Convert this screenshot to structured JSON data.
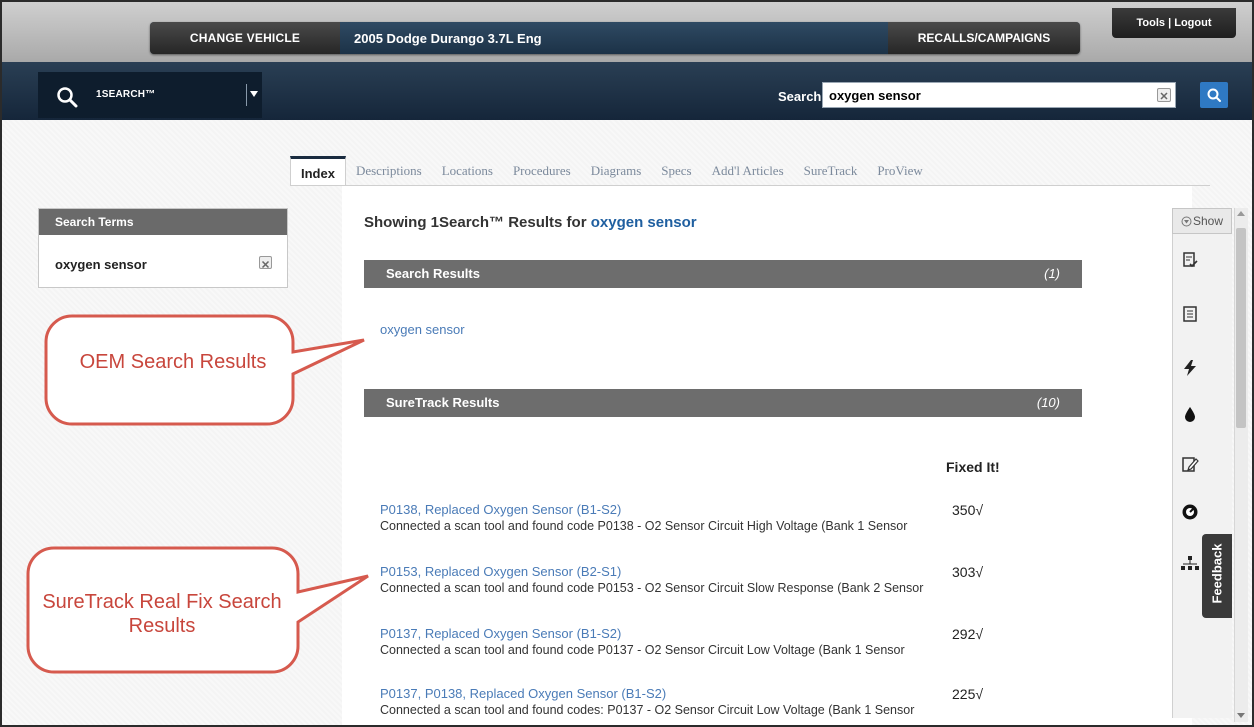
{
  "header": {
    "change_vehicle": "CHANGE VEHICLE",
    "vehicle": "2005 Dodge Durango 3.7L Eng",
    "recalls": "RECALLS/CAMPAIGNS",
    "tools": "Tools | Logout"
  },
  "search": {
    "mode_label": "1SEARCH™",
    "label": "Search",
    "value": "oxygen sensor"
  },
  "tabs": [
    {
      "label": "Index",
      "active": true
    },
    {
      "label": "Descriptions"
    },
    {
      "label": "Locations"
    },
    {
      "label": "Procedures"
    },
    {
      "label": "Diagrams"
    },
    {
      "label": "Specs"
    },
    {
      "label": "Add'l Articles"
    },
    {
      "label": "SureTrack"
    },
    {
      "label": "ProView"
    }
  ],
  "terms": {
    "header": "Search Terms",
    "item": "oxygen sensor"
  },
  "main": {
    "showing_prefix": "Showing 1Search™ Results for ",
    "query": "oxygen sensor",
    "search_results_header": "Search Results",
    "search_results_count": "(1)",
    "oem_link": "oxygen sensor",
    "suretrack_header": "SureTrack Results",
    "suretrack_count": "(10)",
    "fixed_it": "Fixed It!",
    "results": [
      {
        "title": "P0138, Replaced Oxygen Sensor (B1-S2)",
        "count": "350√",
        "desc": "Connected a scan tool and found code P0138 - O2 Sensor Circuit High Voltage (Bank 1 Sensor"
      },
      {
        "title": "P0153, Replaced Oxygen Sensor (B2-S1)",
        "count": "303√",
        "desc": "Connected a scan tool and found code P0153 - O2 Sensor Circuit Slow Response (Bank 2 Sensor"
      },
      {
        "title": "P0137, Replaced Oxygen Sensor (B1-S2)",
        "count": "292√",
        "desc": "Connected a scan tool and found code P0137 - O2 Sensor Circuit Low Voltage (Bank 1 Sensor"
      },
      {
        "title": "P0137, P0138, Replaced Oxygen Sensor (B1-S2)",
        "count": "225√",
        "desc": "Connected a scan tool and found codes: P0137 - O2 Sensor Circuit Low Voltage (Bank 1 Sensor"
      }
    ]
  },
  "rail": {
    "show": "Show",
    "icons": [
      "document-check-icon",
      "document-list-icon",
      "lightning-icon",
      "fluid-drop-icon",
      "edit-document-icon",
      "gauge-icon",
      "network-icon"
    ]
  },
  "feedback": "Feedback",
  "callouts": {
    "oem": "OEM Search Results",
    "suretrack": "SureTrack Real Fix Search Results"
  },
  "colors": {
    "accent_blue": "#2f79c3",
    "link_blue": "#4a7bb7",
    "callout_red": "#c8463c",
    "navy": "#1c3247"
  }
}
